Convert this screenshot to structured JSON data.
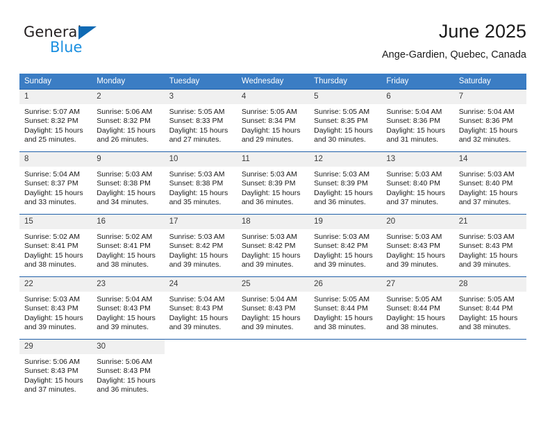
{
  "brand": {
    "name_part1": "General",
    "name_part2": "Blue",
    "logo_icon": "triangle-logo-icon"
  },
  "header": {
    "title": "June 2025",
    "subtitle": "Ange-Gardien, Quebec, Canada"
  },
  "colors": {
    "header_blue": "#3b7dc4",
    "row_rule_blue": "#1f5fa8",
    "daynum_band": "#f0f0f0",
    "brand_dark": "#231f20",
    "brand_blue": "#1a8fe0",
    "logo_blue": "#0f6ab4"
  },
  "weekday_headers": [
    "Sunday",
    "Monday",
    "Tuesday",
    "Wednesday",
    "Thursday",
    "Friday",
    "Saturday"
  ],
  "weeks": [
    [
      {
        "day": "1",
        "sunrise": "Sunrise: 5:07 AM",
        "sunset": "Sunset: 8:32 PM",
        "daylight_line1": "Daylight: 15 hours",
        "daylight_line2": "and 25 minutes."
      },
      {
        "day": "2",
        "sunrise": "Sunrise: 5:06 AM",
        "sunset": "Sunset: 8:32 PM",
        "daylight_line1": "Daylight: 15 hours",
        "daylight_line2": "and 26 minutes."
      },
      {
        "day": "3",
        "sunrise": "Sunrise: 5:05 AM",
        "sunset": "Sunset: 8:33 PM",
        "daylight_line1": "Daylight: 15 hours",
        "daylight_line2": "and 27 minutes."
      },
      {
        "day": "4",
        "sunrise": "Sunrise: 5:05 AM",
        "sunset": "Sunset: 8:34 PM",
        "daylight_line1": "Daylight: 15 hours",
        "daylight_line2": "and 29 minutes."
      },
      {
        "day": "5",
        "sunrise": "Sunrise: 5:05 AM",
        "sunset": "Sunset: 8:35 PM",
        "daylight_line1": "Daylight: 15 hours",
        "daylight_line2": "and 30 minutes."
      },
      {
        "day": "6",
        "sunrise": "Sunrise: 5:04 AM",
        "sunset": "Sunset: 8:36 PM",
        "daylight_line1": "Daylight: 15 hours",
        "daylight_line2": "and 31 minutes."
      },
      {
        "day": "7",
        "sunrise": "Sunrise: 5:04 AM",
        "sunset": "Sunset: 8:36 PM",
        "daylight_line1": "Daylight: 15 hours",
        "daylight_line2": "and 32 minutes."
      }
    ],
    [
      {
        "day": "8",
        "sunrise": "Sunrise: 5:04 AM",
        "sunset": "Sunset: 8:37 PM",
        "daylight_line1": "Daylight: 15 hours",
        "daylight_line2": "and 33 minutes."
      },
      {
        "day": "9",
        "sunrise": "Sunrise: 5:03 AM",
        "sunset": "Sunset: 8:38 PM",
        "daylight_line1": "Daylight: 15 hours",
        "daylight_line2": "and 34 minutes."
      },
      {
        "day": "10",
        "sunrise": "Sunrise: 5:03 AM",
        "sunset": "Sunset: 8:38 PM",
        "daylight_line1": "Daylight: 15 hours",
        "daylight_line2": "and 35 minutes."
      },
      {
        "day": "11",
        "sunrise": "Sunrise: 5:03 AM",
        "sunset": "Sunset: 8:39 PM",
        "daylight_line1": "Daylight: 15 hours",
        "daylight_line2": "and 36 minutes."
      },
      {
        "day": "12",
        "sunrise": "Sunrise: 5:03 AM",
        "sunset": "Sunset: 8:39 PM",
        "daylight_line1": "Daylight: 15 hours",
        "daylight_line2": "and 36 minutes."
      },
      {
        "day": "13",
        "sunrise": "Sunrise: 5:03 AM",
        "sunset": "Sunset: 8:40 PM",
        "daylight_line1": "Daylight: 15 hours",
        "daylight_line2": "and 37 minutes."
      },
      {
        "day": "14",
        "sunrise": "Sunrise: 5:03 AM",
        "sunset": "Sunset: 8:40 PM",
        "daylight_line1": "Daylight: 15 hours",
        "daylight_line2": "and 37 minutes."
      }
    ],
    [
      {
        "day": "15",
        "sunrise": "Sunrise: 5:02 AM",
        "sunset": "Sunset: 8:41 PM",
        "daylight_line1": "Daylight: 15 hours",
        "daylight_line2": "and 38 minutes."
      },
      {
        "day": "16",
        "sunrise": "Sunrise: 5:02 AM",
        "sunset": "Sunset: 8:41 PM",
        "daylight_line1": "Daylight: 15 hours",
        "daylight_line2": "and 38 minutes."
      },
      {
        "day": "17",
        "sunrise": "Sunrise: 5:03 AM",
        "sunset": "Sunset: 8:42 PM",
        "daylight_line1": "Daylight: 15 hours",
        "daylight_line2": "and 39 minutes."
      },
      {
        "day": "18",
        "sunrise": "Sunrise: 5:03 AM",
        "sunset": "Sunset: 8:42 PM",
        "daylight_line1": "Daylight: 15 hours",
        "daylight_line2": "and 39 minutes."
      },
      {
        "day": "19",
        "sunrise": "Sunrise: 5:03 AM",
        "sunset": "Sunset: 8:42 PM",
        "daylight_line1": "Daylight: 15 hours",
        "daylight_line2": "and 39 minutes."
      },
      {
        "day": "20",
        "sunrise": "Sunrise: 5:03 AM",
        "sunset": "Sunset: 8:43 PM",
        "daylight_line1": "Daylight: 15 hours",
        "daylight_line2": "and 39 minutes."
      },
      {
        "day": "21",
        "sunrise": "Sunrise: 5:03 AM",
        "sunset": "Sunset: 8:43 PM",
        "daylight_line1": "Daylight: 15 hours",
        "daylight_line2": "and 39 minutes."
      }
    ],
    [
      {
        "day": "22",
        "sunrise": "Sunrise: 5:03 AM",
        "sunset": "Sunset: 8:43 PM",
        "daylight_line1": "Daylight: 15 hours",
        "daylight_line2": "and 39 minutes."
      },
      {
        "day": "23",
        "sunrise": "Sunrise: 5:04 AM",
        "sunset": "Sunset: 8:43 PM",
        "daylight_line1": "Daylight: 15 hours",
        "daylight_line2": "and 39 minutes."
      },
      {
        "day": "24",
        "sunrise": "Sunrise: 5:04 AM",
        "sunset": "Sunset: 8:43 PM",
        "daylight_line1": "Daylight: 15 hours",
        "daylight_line2": "and 39 minutes."
      },
      {
        "day": "25",
        "sunrise": "Sunrise: 5:04 AM",
        "sunset": "Sunset: 8:43 PM",
        "daylight_line1": "Daylight: 15 hours",
        "daylight_line2": "and 39 minutes."
      },
      {
        "day": "26",
        "sunrise": "Sunrise: 5:05 AM",
        "sunset": "Sunset: 8:44 PM",
        "daylight_line1": "Daylight: 15 hours",
        "daylight_line2": "and 38 minutes."
      },
      {
        "day": "27",
        "sunrise": "Sunrise: 5:05 AM",
        "sunset": "Sunset: 8:44 PM",
        "daylight_line1": "Daylight: 15 hours",
        "daylight_line2": "and 38 minutes."
      },
      {
        "day": "28",
        "sunrise": "Sunrise: 5:05 AM",
        "sunset": "Sunset: 8:44 PM",
        "daylight_line1": "Daylight: 15 hours",
        "daylight_line2": "and 38 minutes."
      }
    ],
    [
      {
        "day": "29",
        "sunrise": "Sunrise: 5:06 AM",
        "sunset": "Sunset: 8:43 PM",
        "daylight_line1": "Daylight: 15 hours",
        "daylight_line2": "and 37 minutes."
      },
      {
        "day": "30",
        "sunrise": "Sunrise: 5:06 AM",
        "sunset": "Sunset: 8:43 PM",
        "daylight_line1": "Daylight: 15 hours",
        "daylight_line2": "and 36 minutes."
      },
      {
        "day": "",
        "sunrise": "",
        "sunset": "",
        "daylight_line1": "",
        "daylight_line2": ""
      },
      {
        "day": "",
        "sunrise": "",
        "sunset": "",
        "daylight_line1": "",
        "daylight_line2": ""
      },
      {
        "day": "",
        "sunrise": "",
        "sunset": "",
        "daylight_line1": "",
        "daylight_line2": ""
      },
      {
        "day": "",
        "sunrise": "",
        "sunset": "",
        "daylight_line1": "",
        "daylight_line2": ""
      },
      {
        "day": "",
        "sunrise": "",
        "sunset": "",
        "daylight_line1": "",
        "daylight_line2": ""
      }
    ]
  ]
}
